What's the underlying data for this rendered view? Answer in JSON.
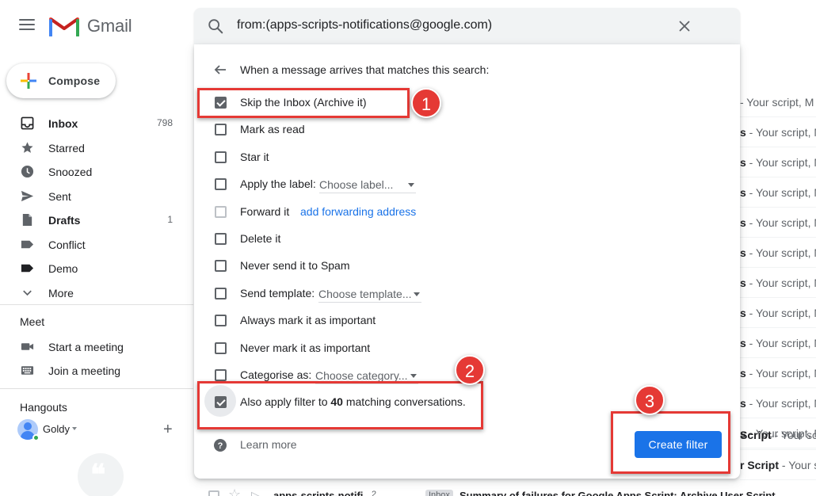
{
  "app": {
    "brand": "Gmail"
  },
  "search": {
    "query": "from:(apps-scripts-notifications@google.com)"
  },
  "compose": {
    "label": "Compose"
  },
  "sidebar": {
    "items": [
      {
        "label": "Inbox",
        "count": "798",
        "icon": "inbox-icon"
      },
      {
        "label": "Starred",
        "count": "",
        "icon": "star-icon"
      },
      {
        "label": "Snoozed",
        "count": "",
        "icon": "clock-icon"
      },
      {
        "label": "Sent",
        "count": "",
        "icon": "send-icon"
      },
      {
        "label": "Drafts",
        "count": "1",
        "icon": "draft-icon"
      },
      {
        "label": "Conflict",
        "count": "",
        "icon": "label-icon"
      },
      {
        "label": "Demo",
        "count": "",
        "icon": "label-icon"
      },
      {
        "label": "More",
        "count": "",
        "icon": "chevron-down-icon"
      }
    ]
  },
  "meet": {
    "title": "Meet",
    "start": "Start a meeting",
    "join": "Join a meeting"
  },
  "hangouts": {
    "title": "Hangouts",
    "user": "Goldy"
  },
  "dialog": {
    "heading": "When a message arrives that matches this search:",
    "options": [
      {
        "label": "Skip the Inbox (Archive it)",
        "checked": true
      },
      {
        "label": "Mark as read",
        "checked": false
      },
      {
        "label": "Star it",
        "checked": false
      },
      {
        "label": "Apply the label:",
        "checked": false,
        "select": "Choose label..."
      },
      {
        "label": "Forward it",
        "checked": false,
        "link": "add forwarding address"
      },
      {
        "label": "Delete it",
        "checked": false
      },
      {
        "label": "Never send it to Spam",
        "checked": false
      },
      {
        "label": "Send template:",
        "checked": false,
        "select": "Choose template..."
      },
      {
        "label": "Always mark it as important",
        "checked": false
      },
      {
        "label": "Never mark it as important",
        "checked": false
      },
      {
        "label": "Categorise as:",
        "checked": false,
        "select": "Choose category..."
      }
    ],
    "also_apply": {
      "prefix": "Also apply filter to ",
      "count": "40",
      "suffix": " matching conversations.",
      "checked": true
    },
    "learn_more": "Learn more",
    "create_button": "Create filter"
  },
  "mail_list": {
    "rows": [
      {
        "bold": "",
        "text": "- Your script, M"
      },
      {
        "bold": "s",
        "text": " - Your script, M"
      },
      {
        "bold": "s",
        "text": " - Your script, M"
      },
      {
        "bold": "s",
        "text": " - Your script, M"
      },
      {
        "bold": "s",
        "text": " - Your script, M"
      },
      {
        "bold": "s",
        "text": " - Your script, M"
      },
      {
        "bold": "s",
        "text": " - Your script, M"
      },
      {
        "bold": "s",
        "text": " - Your script, M"
      },
      {
        "bold": "s",
        "text": " - Your script, M"
      },
      {
        "bold": "s",
        "text": " - Your script, M"
      },
      {
        "bold": "s",
        "text": " - Your script, M"
      },
      {
        "bold": "s",
        "text": " - Your script, M"
      },
      {
        "bold": "Script",
        "text": " - Your scr"
      },
      {
        "bold": "r Script",
        "text": " - Your sc"
      }
    ],
    "bottom": {
      "sender": "apps-scripts-notifi",
      "count": "2",
      "badge": "Inbox",
      "subject": "Summary of failures for Google Apps Script: Archive User Script"
    }
  },
  "annotations": [
    "1",
    "2",
    "3"
  ],
  "colors": {
    "accent": "#1a73e8",
    "annotation": "#e53935",
    "gmail_red": "#ea4335"
  }
}
